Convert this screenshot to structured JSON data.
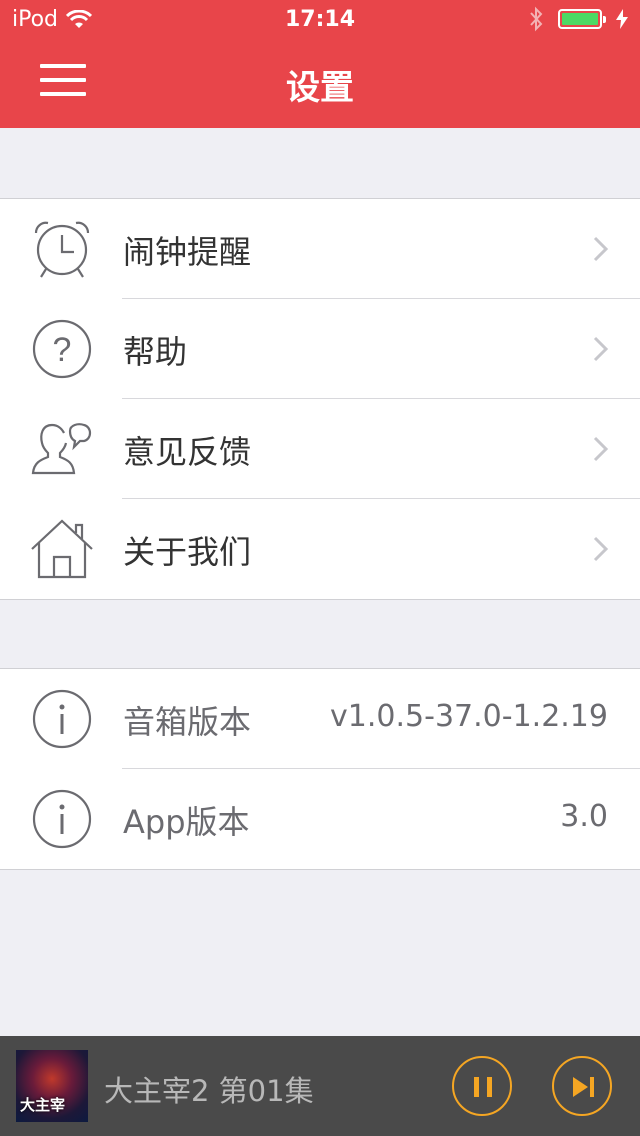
{
  "status_bar": {
    "carrier": "iPod",
    "time": "17:14",
    "battery_level": 1.0,
    "icons": [
      "wifi-icon",
      "bluetooth-icon",
      "battery-icon",
      "charging-icon"
    ]
  },
  "navbar": {
    "title": "设置",
    "menu_icon": "hamburger-menu-icon"
  },
  "settings": [
    {
      "label": "闹钟提醒",
      "icon": "alarm-clock-icon"
    },
    {
      "label": "帮助",
      "icon": "help-question-icon"
    },
    {
      "label": "意见反馈",
      "icon": "feedback-person-icon"
    },
    {
      "label": "关于我们",
      "icon": "home-icon"
    }
  ],
  "info": [
    {
      "label": "音箱版本",
      "value": "v1.0.5-37.0-1.2.19",
      "icon": "info-icon"
    },
    {
      "label": "App版本",
      "value": "3.0",
      "icon": "info-icon"
    }
  ],
  "player": {
    "track": "大主宰2 第01集",
    "cover_text": "大主宰",
    "controls": [
      "pause-icon",
      "next-track-icon"
    ]
  },
  "colors": {
    "accent": "#e8454a",
    "player_bg": "#4a4a4a",
    "player_control": "#f5a623",
    "page_bg": "#efeff4"
  }
}
